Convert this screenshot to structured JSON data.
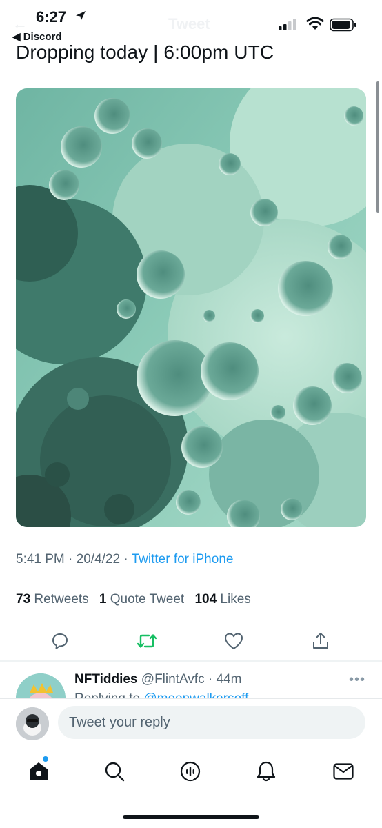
{
  "status_bar": {
    "time": "6:27",
    "back_app": "◀ Discord",
    "header_title": "Tweet"
  },
  "tweet": {
    "text": "Dropping today | 6:00pm UTC",
    "media": {
      "icon": "moon-crater-image"
    },
    "time": "5:41 PM",
    "date": "20/4/22",
    "source": "Twitter for iPhone",
    "stats": {
      "retweets_count": "73",
      "retweets_label": "Retweets",
      "quotes_count": "1",
      "quotes_label": "Quote Tweet",
      "likes_count": "104",
      "likes_label": "Likes"
    },
    "actions": [
      "reply-icon",
      "retweet-icon",
      "like-icon",
      "share-icon"
    ],
    "colors": {
      "retweet_active": "#17bf63",
      "link": "#1d9bf0"
    }
  },
  "reply": {
    "name": "NFTiddies",
    "handle": "@FlintAvfc",
    "age": "· 44m",
    "more": "•••",
    "sub_prefix": "Replying to",
    "sub_link": "@moonwalkersoff"
  },
  "composer": {
    "placeholder": "Tweet your reply"
  },
  "tab_bar": {
    "items": [
      "home-icon",
      "search-icon",
      "spaces-icon",
      "notifications-icon",
      "messages-icon"
    ]
  }
}
